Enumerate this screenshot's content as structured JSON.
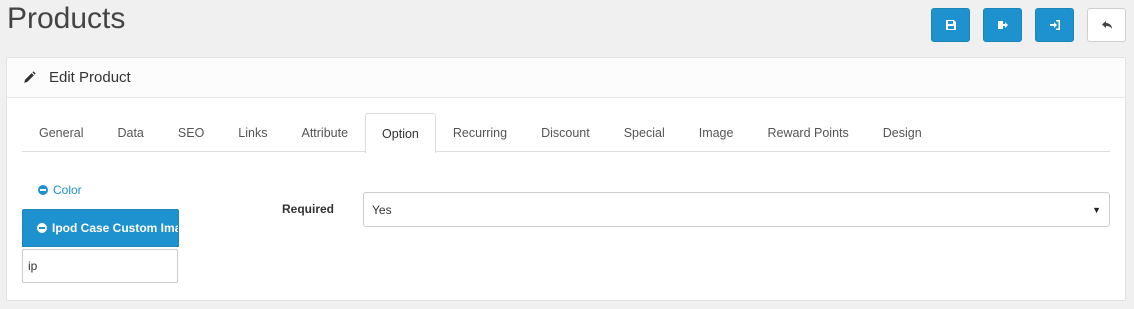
{
  "page": {
    "title": "Products"
  },
  "actions": [
    {
      "name": "save-button",
      "icon": "save-icon"
    },
    {
      "name": "export-button",
      "icon": "sign-out-icon"
    },
    {
      "name": "import-button",
      "icon": "sign-in-icon"
    },
    {
      "name": "back-button",
      "icon": "reply-icon"
    }
  ],
  "panel": {
    "title": "Edit Product",
    "icon": "pencil-icon"
  },
  "tabs": [
    "General",
    "Data",
    "SEO",
    "Links",
    "Attribute",
    "Option",
    "Recurring",
    "Discount",
    "Special",
    "Image",
    "Reward Points",
    "Design"
  ],
  "active_tab": "Option",
  "options": {
    "color_label": "Color",
    "active_label": "Ipod Case Custom Image",
    "input_value": "ip"
  },
  "required": {
    "label": "Required",
    "value": "Yes"
  },
  "colors": {
    "primary": "#1e91cf",
    "background": "#f0f0f0"
  }
}
